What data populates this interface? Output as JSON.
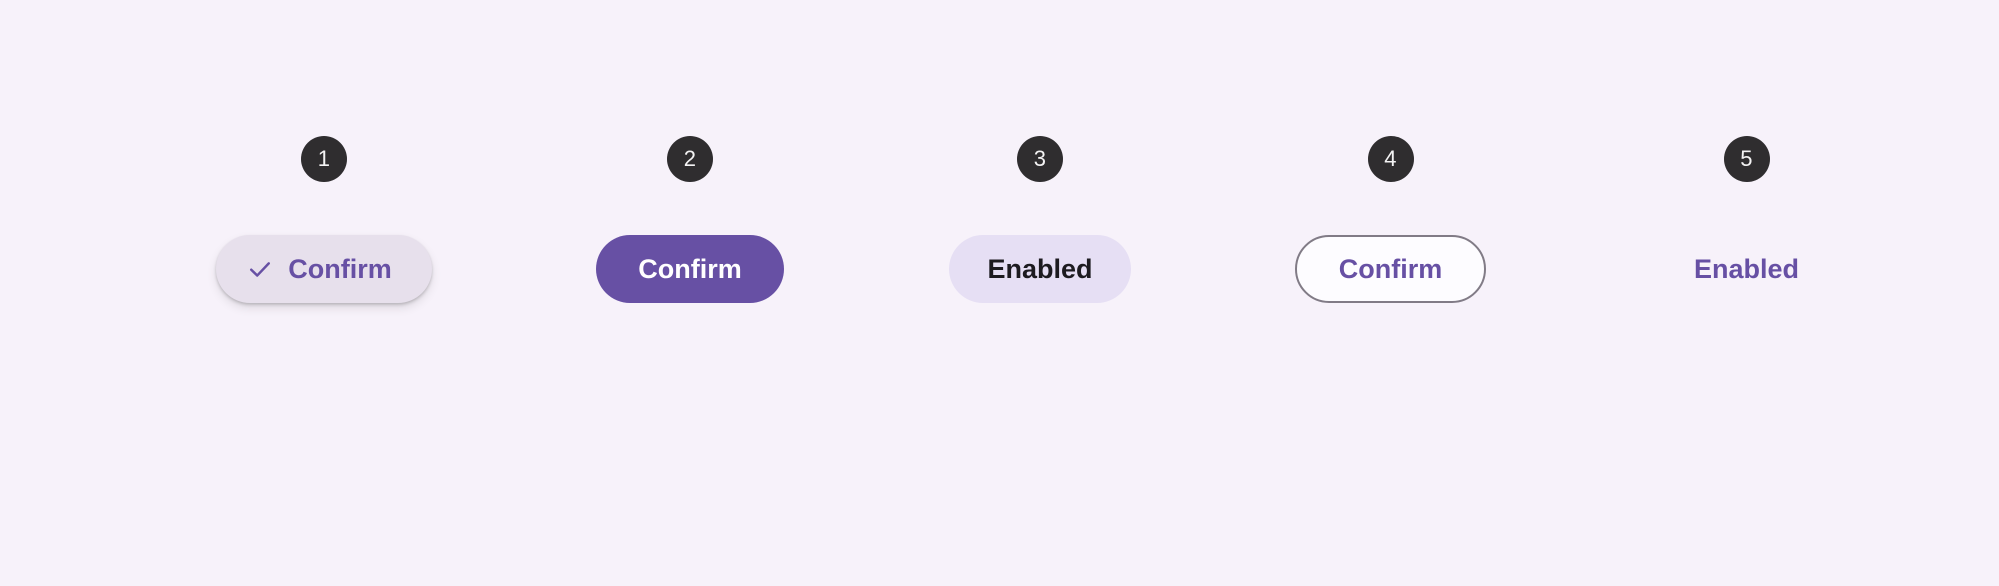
{
  "page": {
    "background_color": "#F7F2FA",
    "accent_color": "#6750A4"
  },
  "badges": {
    "background_color": "#2F2D2F",
    "text_color": "#F4F3F4"
  },
  "variants": [
    {
      "number": "1",
      "style": "tonal-elevated-with-icon",
      "label": "Confirm",
      "icon": "check-icon",
      "has_icon": true,
      "background_color": "#E7E0EC",
      "text_color": "#6750A4",
      "elevated": true
    },
    {
      "number": "2",
      "style": "filled",
      "label": "Confirm",
      "has_icon": false,
      "background_color": "#6750A4",
      "text_color": "#FFFFFF",
      "elevated": false
    },
    {
      "number": "3",
      "style": "tonal",
      "label": "Enabled",
      "has_icon": false,
      "background_color": "#E6DFF4",
      "text_color": "#1D1B20",
      "elevated": false
    },
    {
      "number": "4",
      "style": "outlined",
      "label": "Confirm",
      "has_icon": false,
      "background_color": "#FDFCFF",
      "border_color": "#817B86",
      "text_color": "#6750A4",
      "elevated": false
    },
    {
      "number": "5",
      "style": "text",
      "label": "Enabled",
      "has_icon": false,
      "background_color": "transparent",
      "text_color": "#6750A4",
      "elevated": false
    }
  ]
}
